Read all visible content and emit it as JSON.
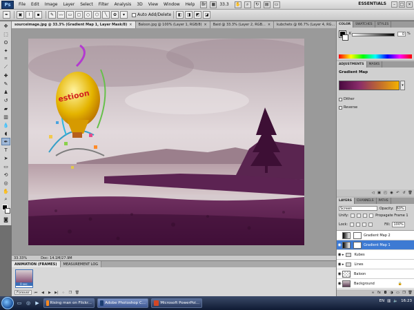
{
  "menubar": {
    "logo": "Ps",
    "items": [
      "File",
      "Edit",
      "Image",
      "Layer",
      "Select",
      "Filter",
      "Analysis",
      "3D",
      "View",
      "Window",
      "Help"
    ],
    "zoom": "33.3",
    "workspace": "ESSENTIALS"
  },
  "optionsbar": {
    "auto_add_delete": "Auto Add/Delete"
  },
  "doctabs": [
    {
      "label": "sourceimage.jpg @ 33.3% (Gradient Map 1, Layer Mask/8)",
      "active": true
    },
    {
      "label": "Baloon.jpg @ 100% (Layer 1, RGB/8)",
      "active": false
    },
    {
      "label": "Baid @ 33.3% (Layer 2, RGB...",
      "active": false
    },
    {
      "label": "kubchets @ 66.7% (Layer 4, RG...",
      "active": false
    }
  ],
  "status": {
    "zoom": "33.33%",
    "doc": "Doc: 14.1M/27.9M"
  },
  "animation": {
    "tabs": [
      "ANIMATION (FRAMES)",
      "MEASUREMENT LOG"
    ],
    "frame_time": "0 sec.",
    "loop": "Forever"
  },
  "colorpanel": {
    "tabs": [
      "COLOR",
      "SWATCHES",
      "STYLES"
    ],
    "channel": "K",
    "value": "0",
    "pct": "%"
  },
  "adjpanel": {
    "tabs": [
      "ADJUSTMENTS",
      "MASKS"
    ],
    "title": "Gradient Map",
    "dither": "Dither",
    "reverse": "Reverse"
  },
  "layerspanel": {
    "tabs": [
      "LAYERS",
      "CHANNELS",
      "PATHS"
    ],
    "blend_mode": "Screen",
    "opacity_label": "Opacity:",
    "opacity": "60%",
    "unify_label": "Unify:",
    "propagate": "Propagate Frame 1",
    "lock_label": "Lock:",
    "fill_label": "Fill:",
    "fill": "100%",
    "layers": [
      {
        "name": "Gradient Map 2",
        "type": "adjust",
        "visible": false,
        "selected": false
      },
      {
        "name": "Gradient Map 1",
        "type": "adjust",
        "visible": true,
        "selected": true
      },
      {
        "name": "Kubes",
        "type": "group",
        "visible": true,
        "selected": false
      },
      {
        "name": "Lines",
        "type": "group",
        "visible": true,
        "selected": false
      },
      {
        "name": "Baloon",
        "type": "layer",
        "visible": true,
        "selected": false
      },
      {
        "name": "Background",
        "type": "background",
        "visible": true,
        "selected": false
      }
    ]
  },
  "taskbar": {
    "tasks": [
      {
        "label": "Rising man on Flickr...",
        "active": false,
        "color": "#ff8a1f"
      },
      {
        "label": "Adobe Photoshop C...",
        "active": true,
        "color": "#1b3d71"
      },
      {
        "label": "Microsoft PowerPoi...",
        "active": false,
        "color": "#d24726"
      }
    ],
    "lang": "EN",
    "time": "16:23"
  },
  "colors": {
    "selection": "#3d7ad3",
    "gradient_start": "#4a0a40",
    "gradient_end": "#f3b100"
  }
}
